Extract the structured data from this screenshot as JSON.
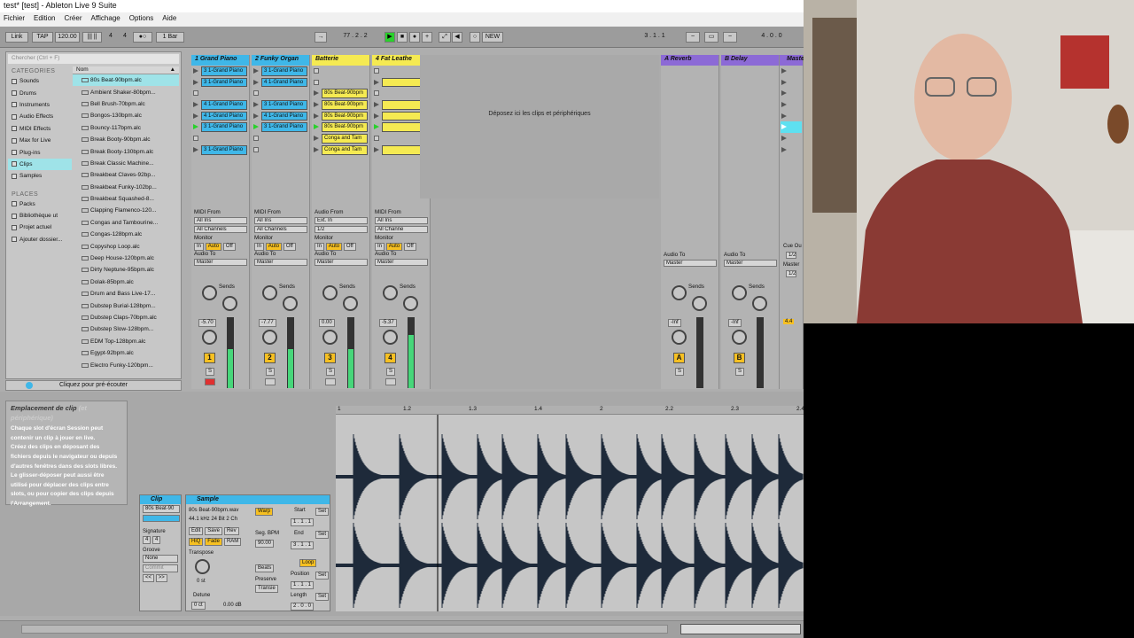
{
  "window": {
    "title": "test* [test] - Ableton Live 9 Suite"
  },
  "menu": [
    "Fichier",
    "Edition",
    "Créer",
    "Affichage",
    "Options",
    "Aide"
  ],
  "control_bar": {
    "link": "Link",
    "tap": "TAP",
    "tempo": "120.00",
    "sig_num": "4",
    "sig_den": "4",
    "dot": "●○",
    "quant": "1 Bar",
    "arr_pos": "77 . 2 . 2",
    "new": "NEW",
    "loop_start": "3 . 1 . 1",
    "loop_len": "4 . 0 . 0"
  },
  "browser": {
    "search_placeholder": "Chercher (Ctrl + F)",
    "categories_label": "CATEGORIES",
    "categories": [
      "Sounds",
      "Drums",
      "Instruments",
      "Audio Effects",
      "MIDI Effects",
      "Max for Live",
      "Plug-ins",
      "Clips",
      "Samples"
    ],
    "places_label": "PLACES",
    "places": [
      "Packs",
      "Bibliothèque ut",
      "Projet actuel",
      "Ajouter dossier..."
    ],
    "name_header": "Nom",
    "files": [
      "80s Beat-90bpm.alc",
      "Ambient Shaker-80bpm...",
      "Bell Brush-70bpm.alc",
      "Bongos-130bpm.alc",
      "Bouncy-117bpm.alc",
      "Break Booty-90bpm.alc",
      "Break Booty-130bpm.alc",
      "Break Classic Machine...",
      "Breakbeat Claves-92bp...",
      "Breakbeat Funky-102bp...",
      "Breakbeat Squashed-8...",
      "Clapping Flamenco-120...",
      "Congas and Tambourine...",
      "Congas-128bpm.alc",
      "Copyshop Loop.alc",
      "Deep House-120bpm.alc",
      "Dirty Neptune-95bpm.alc",
      "Dolak-85bpm.alc",
      "Drum and Bass Live-17...",
      "Dubstep Burial-128bpm...",
      "Dubstep Claps-70bpm.alc",
      "Dubstep Slow-128bpm...",
      "EDM Top-128bpm.alc",
      "Egypt-92bpm.alc",
      "Electro Funky-120bpm..."
    ],
    "preview": "Cliquez pour pré-écouter"
  },
  "tracks": [
    {
      "name": "1 Grand Piano",
      "color": "#3fb7e8",
      "clips": [
        "3 1-Grand Piano",
        "3 1-Grand Piano",
        "",
        "4 1-Grand Piano",
        "4 1-Grand Piano",
        "3 1-Grand Piano",
        "",
        "3 1-Grand Piano"
      ],
      "from": "MIDI From",
      "src": "All Ins",
      "ch": "All Channels",
      "out": "Master",
      "vol": "-5.70",
      "num": "1"
    },
    {
      "name": "2 Funky Organ",
      "color": "#3fb7e8",
      "clips": [
        "3 1-Grand Piano",
        "4 1-Grand Piano",
        "",
        "3 1-Grand Piano",
        "4 1-Grand Piano",
        "3 1-Grand Piano",
        "",
        ""
      ],
      "from": "MIDI From",
      "src": "All Ins",
      "ch": "All Channels",
      "out": "Master",
      "vol": "-7.77",
      "num": "2"
    },
    {
      "name": "Batterie",
      "color": "#f5ea52",
      "clips": [
        "",
        "",
        "80s Beat-90bpm",
        "80s Beat-90bpm",
        "80s Beat-90bpm",
        "80s Beat-90bpm",
        "Conga and Tam",
        "Conga and Tam"
      ],
      "from": "Audio From",
      "src": "Ext. In",
      "ch": "1/2",
      "out": "Master",
      "vol": "0.00",
      "num": "3"
    },
    {
      "name": "4 Fat Leathe",
      "color": "#f5ea52",
      "clips": [
        "",
        "c",
        "",
        "c",
        "c",
        "c",
        "",
        "c"
      ],
      "from": "MIDI From",
      "src": "All Ins",
      "ch": "All Channe",
      "out": "Master",
      "vol": "-5.37",
      "num": "4"
    }
  ],
  "monitor": {
    "label": "Monitor",
    "in": "In",
    "auto": "Auto",
    "off": "Off",
    "audio_to": "Audio To",
    "sends": "Sends"
  },
  "returns": [
    {
      "name": "A Reverb",
      "color": "#8c6ad6",
      "num": "A",
      "vol": "-Inf"
    },
    {
      "name": "B Delay",
      "color": "#8c6ad6",
      "num": "B",
      "vol": "-Inf"
    }
  ],
  "master": {
    "name": "Maste",
    "cue": "Cue Ou",
    "cue_val": "1/2",
    "master_out": "Master",
    "master_val": "1/2",
    "vol": "4.4"
  },
  "drop_hint": "Déposez ici les clips et périphériques",
  "info": {
    "title": "Emplacement de clip",
    "faded": "(et périphérique)",
    "lines": [
      "Chaque slot d'écran Session peut",
      "contenir un clip à jouer en live.",
      "Créez des clips en déposant des",
      "fichiers depuis le navigateur ou depuis",
      "d'autres fenêtres dans des slots libres.",
      "Le glisser-déposer peut aussi être",
      "utilisé pour déplacer des clips entre",
      "slots, ou pour copier des clips depuis",
      "l'Arrangement."
    ]
  },
  "clip_panel": {
    "title": "Clip",
    "name": "80s Beat-90",
    "signature": "Signature",
    "sig_num": "4",
    "sig_den": "4",
    "groove": "Groove",
    "groove_val": "None",
    "commit": "Commit"
  },
  "sample_panel": {
    "title": "Sample",
    "file": "80s Beat-90bpm.wav",
    "format": "44.1 kHz 24 Bit 2 Ch",
    "edit": "Edit",
    "save": "Save",
    "rev": "Rev",
    "hiq": "HiQ",
    "fade": "Fade",
    "ram": "RAM",
    "transpose": "Transpose",
    "semi": "0 st",
    "detune": "Detune",
    "ct": "0 ct",
    "gain": "0.00 dB",
    "warp": "Warp",
    "seg_bpm": "Seg. BPM",
    "bpm": "90.00",
    "beats": "Beats",
    "preserve": "Preserve",
    "transients": "Transie",
    "start": "Start",
    "end": "End",
    "loop": "Loop",
    "position": "Position",
    "length": "Length",
    "set": "Set",
    "start_val": "1 . 1 . 1",
    "end_val": "3 . 1 . 1",
    "pos_val": "1 . 1 . 1",
    "len_val": "2 . 0 . 0"
  },
  "ruler_ticks": [
    "1",
    "1.2",
    "1.3",
    "1.4",
    "2",
    "2.2",
    "2.3",
    "2.4"
  ]
}
